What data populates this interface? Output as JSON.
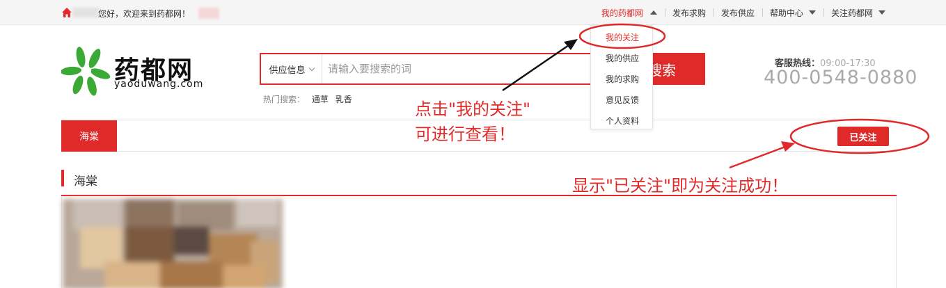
{
  "topbar": {
    "greeting": "您好，欢迎来到药都网！",
    "nav": [
      {
        "label": "我的药都网",
        "active": true,
        "caret": "up"
      },
      {
        "label": "发布求购"
      },
      {
        "label": "发布供应"
      },
      {
        "label": "帮助中心",
        "caret": "down"
      },
      {
        "label": "关注药都网",
        "caret": "down"
      }
    ]
  },
  "dropdown": [
    "我的关注",
    "我的供应",
    "我的求购",
    "意见反馈",
    "个人资料"
  ],
  "logo": {
    "name": "药都网",
    "domain": "yaoduwang.com"
  },
  "search": {
    "category": "供应信息",
    "placeholder": "请输入要搜索的词",
    "button": "搜索",
    "hot_label": "热门搜索：",
    "hot_keywords": [
      "通草",
      "乳香"
    ]
  },
  "hotline": {
    "label": "客服热线：",
    "hours": "09:00-17:30",
    "number": "400-0548-0880"
  },
  "followbar": {
    "tab": "海棠",
    "follow_button": "已关注"
  },
  "section": {
    "title": "海棠"
  },
  "annotations": {
    "dropdown_line1": "点击\"我的关注\"",
    "dropdown_line2": "可进行查看！",
    "follow": "显示\"已关注\"即为关注成功！"
  },
  "colors": {
    "accent": "#e02a2a",
    "logo_green": "#3aa935"
  }
}
